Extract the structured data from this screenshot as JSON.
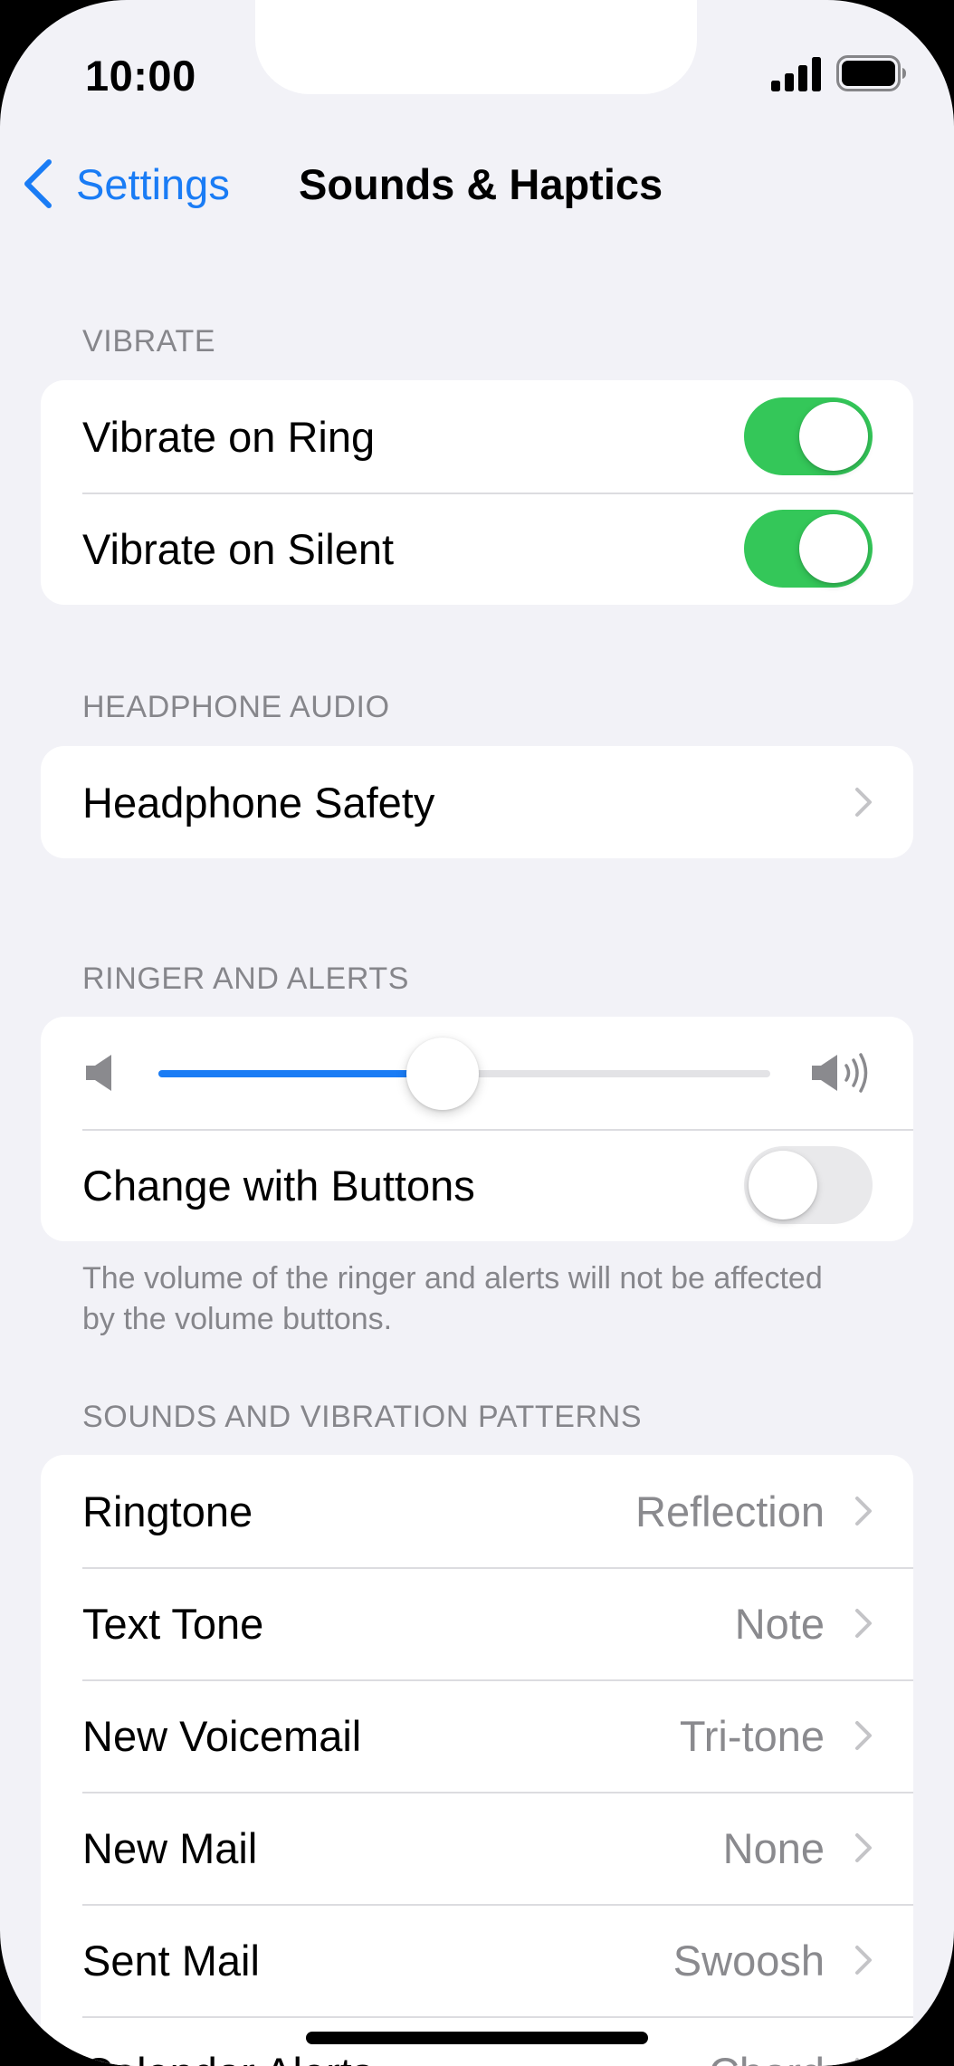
{
  "status_bar": {
    "time": "10:00",
    "signal_icon": "cellular-signal-icon",
    "battery_icon": "battery-full-icon"
  },
  "nav": {
    "back_label": "Settings",
    "title": "Sounds & Haptics"
  },
  "vibrate": {
    "header": "VIBRATE",
    "items": [
      {
        "label": "Vibrate on Ring",
        "on": true
      },
      {
        "label": "Vibrate on Silent",
        "on": true
      }
    ]
  },
  "headphone_audio": {
    "header": "HEADPHONE AUDIO",
    "items": [
      {
        "label": "Headphone Safety"
      }
    ]
  },
  "ringer": {
    "header": "RINGER AND ALERTS",
    "volume_fraction": 0.465,
    "change_with_buttons": {
      "label": "Change with Buttons",
      "on": false
    },
    "footer": "The volume of the ringer and alerts will not be affected by the volume buttons."
  },
  "sounds": {
    "header": "SOUNDS AND VIBRATION PATTERNS",
    "items": [
      {
        "label": "Ringtone",
        "value": "Reflection"
      },
      {
        "label": "Text Tone",
        "value": "Note"
      },
      {
        "label": "New Voicemail",
        "value": "Tri-tone"
      },
      {
        "label": "New Mail",
        "value": "None"
      },
      {
        "label": "Sent Mail",
        "value": "Swoosh"
      },
      {
        "label": "Calendar Alerts",
        "value": "Chord"
      }
    ]
  },
  "colors": {
    "accent": "#1a7cf5",
    "toggle_on": "#34c759",
    "toggle_off": "#e9e9eb",
    "background": "#f2f2f7"
  }
}
